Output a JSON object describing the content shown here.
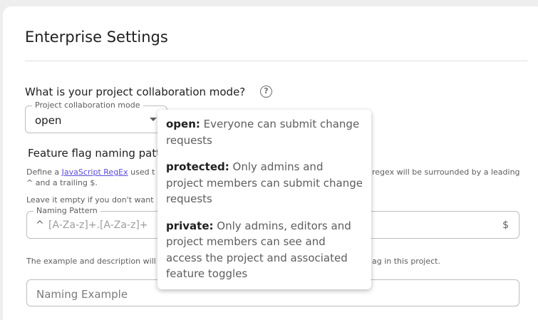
{
  "page": {
    "title": "Enterprise Settings"
  },
  "collaboration": {
    "question": "What is your project collaboration mode?",
    "select_label": "Project collaboration mode",
    "select_value": "open",
    "help_icon": "help-circle-icon"
  },
  "tooltip": {
    "items": [
      {
        "term": "open:",
        "text": " Everyone can submit change requests"
      },
      {
        "term": "protected:",
        "text": " Only admins and project members can submit change requests"
      },
      {
        "term": "private:",
        "text": " Only admins, editors and project members can see and access the project and associated feature toggles"
      }
    ]
  },
  "naming": {
    "heading": "Feature flag naming pattern",
    "desc1_prefix": "Define a ",
    "desc1_link": "JavaScript RegEx",
    "desc1_mid": " used t",
    "desc1_right": "regex will be surrounded by a leading",
    "desc1_line2": "^ and a trailing $.",
    "desc2": "Leave it empty if you don't want",
    "pattern_label": "Naming Pattern",
    "pattern_prefix": "^",
    "pattern_placeholder": "[A-Za-z]+.[A-Za-z]+",
    "pattern_suffix": "$",
    "desc3_left": "The example and description will",
    "desc3_right": "ag in this project.",
    "example_placeholder": "Naming Example"
  },
  "colors": {
    "accent": "#5b4dd6",
    "text": "#202021",
    "muted": "#5d5d60"
  }
}
